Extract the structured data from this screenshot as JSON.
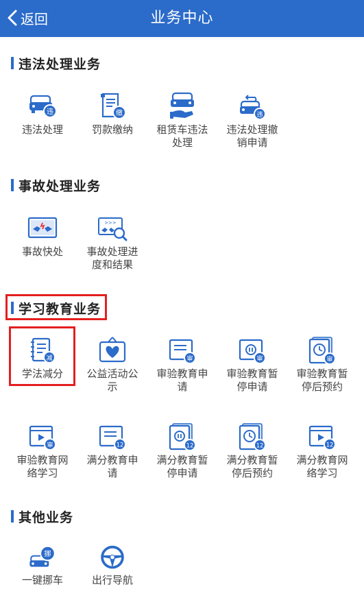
{
  "header": {
    "back_label": "返回",
    "title": "业务中心"
  },
  "colors": {
    "brand": "#2b6bc9",
    "icon_blue": "#2b6bc9",
    "highlight": "#e41f1f"
  },
  "sections": {
    "violation": {
      "title": "违法处理业务",
      "items": [
        {
          "label": "违法处理",
          "icon": "car-violation-icon",
          "badge": "违"
        },
        {
          "label": "罚款缴纳",
          "icon": "fine-payment-icon",
          "badge": "缴"
        },
        {
          "label": "租赁车违法处理",
          "icon": "rental-car-icon",
          "badge": ""
        },
        {
          "label": "违法处理撤销申请",
          "icon": "violation-revoke-icon",
          "badge": "违"
        }
      ]
    },
    "accident": {
      "title": "事故处理业务",
      "items": [
        {
          "label": "事故快处",
          "icon": "accident-quick-icon",
          "badge": ""
        },
        {
          "label": "事故处理进度和结果",
          "icon": "accident-progress-icon",
          "badge": ""
        }
      ]
    },
    "education": {
      "title": "学习教育业务",
      "items": [
        {
          "label": "学法减分",
          "icon": "study-deduct-icon",
          "badge": "减"
        },
        {
          "label": "公益活动公示",
          "icon": "charity-activity-icon",
          "badge": ""
        },
        {
          "label": "审验教育申请",
          "icon": "review-education-icon",
          "badge": "审"
        },
        {
          "label": "审验教育暂停申请",
          "icon": "review-pause-icon",
          "badge": "审"
        },
        {
          "label": "审验教育暂停后预约",
          "icon": "review-appointment-icon",
          "badge": "审"
        },
        {
          "label": "审验教育网络学习",
          "icon": "review-online-icon",
          "badge": "审"
        },
        {
          "label": "满分教育申请",
          "icon": "full-score-education-icon",
          "badge": "12"
        },
        {
          "label": "满分教育暂停申请",
          "icon": "full-score-pause-icon",
          "badge": "12"
        },
        {
          "label": "满分教育暂停后预约",
          "icon": "full-score-appointment-icon",
          "badge": "12"
        },
        {
          "label": "满分教育网络学习",
          "icon": "full-score-online-icon",
          "badge": "12"
        }
      ]
    },
    "other": {
      "title": "其他业务",
      "items": [
        {
          "label": "一键挪车",
          "icon": "move-car-icon",
          "badge": "挪"
        },
        {
          "label": "出行导航",
          "icon": "navigation-wheel-icon",
          "badge": ""
        }
      ]
    }
  }
}
